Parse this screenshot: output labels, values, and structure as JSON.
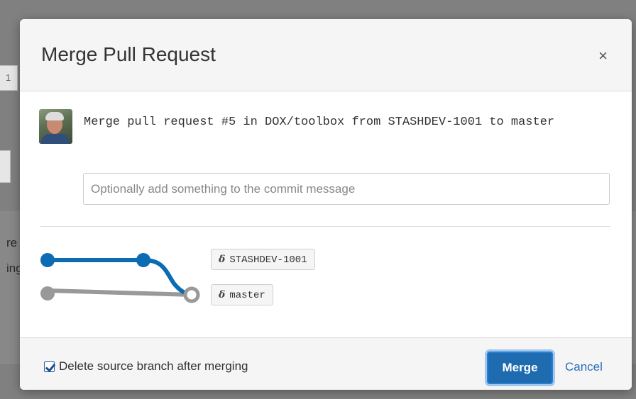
{
  "background": {
    "box_text": "1",
    "snippet_1": "re",
    "snippet_2": "ing"
  },
  "dialog": {
    "title": "Merge Pull Request",
    "close_glyph": "×",
    "commit_message": "Merge pull request #5 in DOX/toolbox from STASHDEV-1001 to master",
    "input": {
      "placeholder": "Optionally add something to the commit message",
      "value": ""
    },
    "branches": {
      "icon_glyph": "ẟ",
      "source": "STASHDEV-1001",
      "target": "master"
    },
    "footer": {
      "delete_checkbox_checked": true,
      "delete_label": "Delete source branch after merging",
      "merge_label": "Merge",
      "cancel_label": "Cancel"
    }
  },
  "colors": {
    "source_branch": "#0b6cb3",
    "target_branch": "#999999",
    "primary_button": "#1e6bb0",
    "link": "#2a6fb8"
  }
}
